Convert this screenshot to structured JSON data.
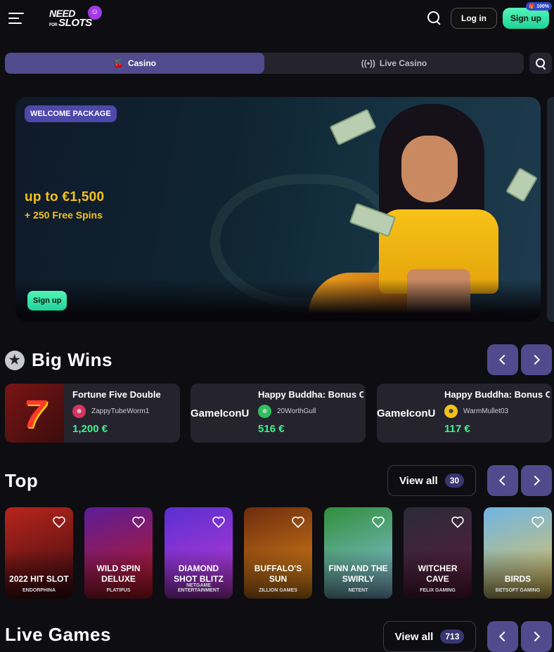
{
  "header": {
    "logo": {
      "line1": "NEED",
      "line2_prefix": "FOR",
      "line2": "SLOTS"
    },
    "login_label": "Log in",
    "signup_label": "Sign up",
    "bonus_badge": "100%"
  },
  "tabs": [
    {
      "label": "Casino",
      "icon": "cherries-icon",
      "active": true
    },
    {
      "label": "Live Casino",
      "icon": "broadcast-icon",
      "active": false
    }
  ],
  "banner": {
    "badge": "WELCOME PACKAGE",
    "amount": "up to €1,500",
    "spins": "+ 250 Free Spins",
    "cta": "Sign up"
  },
  "big_wins": {
    "title": "Big Wins",
    "items": [
      {
        "game": "Fortune Five Double",
        "thumb": "7",
        "user": "ZappyTubeWorm1",
        "amount": "1,200 €"
      },
      {
        "game": "Happy Buddha: Bonus Combo",
        "thumb": "GameIconU",
        "user": "20WorthGull",
        "amount": "516 €"
      },
      {
        "game": "Happy Buddha: Bonus Combo",
        "thumb": "GameIconU",
        "user": "WarmMullet03",
        "amount": "117 €"
      }
    ]
  },
  "top": {
    "title": "Top",
    "view_all": "View all",
    "count": "30",
    "games": [
      {
        "title": "2022 HIT SLOT",
        "provider": "ENDORPHINA",
        "colors": [
          "#b8251c",
          "#3a0b10"
        ]
      },
      {
        "title": "WILD SPIN DELUXE",
        "provider": "PLATIPUS",
        "colors": [
          "#5b1d98",
          "#c2181e"
        ]
      },
      {
        "title": "DIAMOND SHOT BLITZ",
        "provider": "NETGAME ENTERTAINMENT",
        "colors": [
          "#5a2fd0",
          "#c23ad6"
        ]
      },
      {
        "title": "BUFFALO'S SUN",
        "provider": "ZILLION GAMES",
        "colors": [
          "#6d2c0d",
          "#e38a1b"
        ]
      },
      {
        "title": "FINN AND THE SWIRLY",
        "provider": "NETENT",
        "colors": [
          "#2f8f3b",
          "#8ec6e8"
        ]
      },
      {
        "title": "WITCHER CAVE",
        "provider": "FELIX GAMING",
        "colors": [
          "#2b2b38",
          "#5c1a3e"
        ]
      },
      {
        "title": "BIRDS",
        "provider": "BETSOFT GAMING",
        "colors": [
          "#6fb5e4",
          "#e7c356"
        ]
      }
    ]
  },
  "live_games": {
    "title": "Live Games",
    "view_all": "View all",
    "count": "713"
  }
}
